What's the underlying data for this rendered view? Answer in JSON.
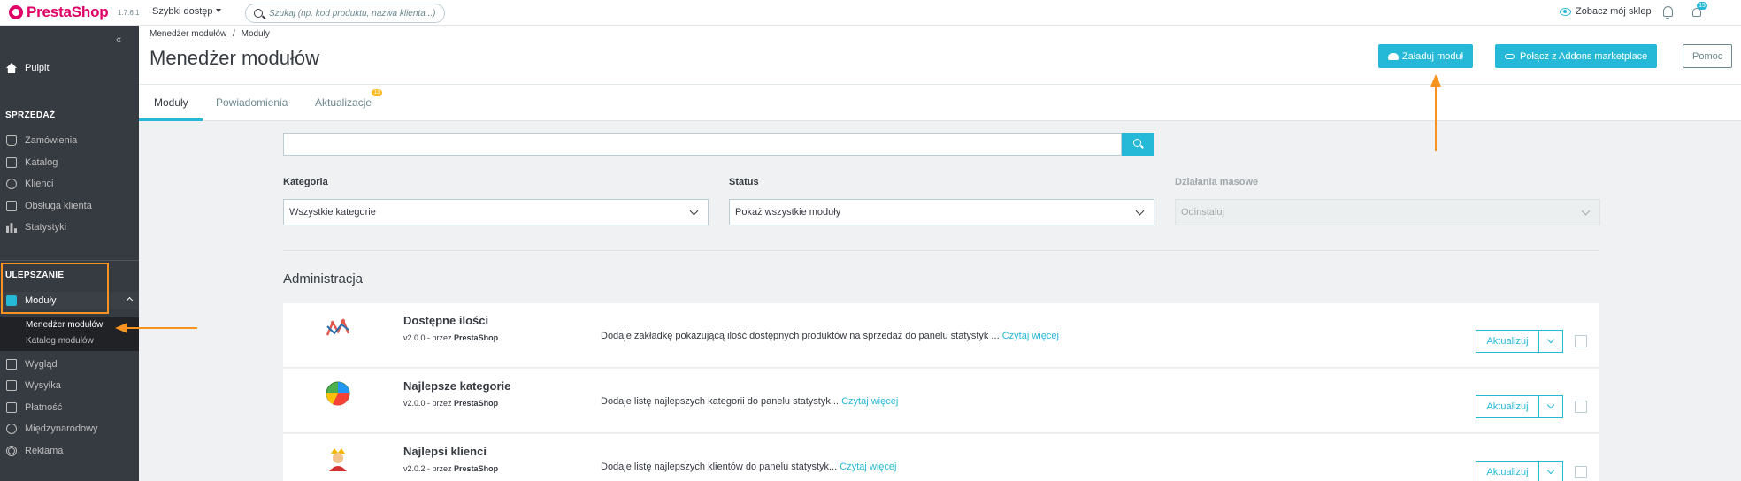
{
  "topbar": {
    "brand_prefix": "Presta",
    "brand_suffix": "Shop",
    "version": "1.7.6.1",
    "quick_access": "Szybki dostęp",
    "search_placeholder": "Szukaj (np. kod produktu, nazwa klienta...)",
    "view_shop": "Zobacz mój sklep",
    "notif_count": "15"
  },
  "sidebar": {
    "dashboard": "Pulpit",
    "section_sell": "SPRZEDAŻ",
    "sell_items": [
      "Zamówienia",
      "Katalog",
      "Klienci",
      "Obsługa klienta",
      "Statystyki"
    ],
    "section_improve": "ULEPSZANIE",
    "modules": "Moduły",
    "sub_items": [
      "Menedżer modułów",
      "Katalog modułów"
    ],
    "improve_items": [
      "Wygląd",
      "Wysyłka",
      "Płatność",
      "Międzynarodowy",
      "Reklama"
    ]
  },
  "header": {
    "breadcrumb_1": "Menedżer modułów",
    "breadcrumb_sep": "/",
    "breadcrumb_2": "Moduły",
    "title": "Menedżer modułów",
    "upload_button": "Załaduj moduł",
    "addons_button": "Połącz z Addons marketplace",
    "help_button": "Pomoc"
  },
  "tabs": {
    "items": [
      "Moduły",
      "Powiadomienia",
      "Aktualizacje"
    ],
    "updates_badge": "13"
  },
  "filters": {
    "search_value": "",
    "category_label": "Kategoria",
    "category_value": "Wszystkie kategorie",
    "status_label": "Status",
    "status_value": "Pokaż wszystkie moduły",
    "bulk_label": "Działania masowe",
    "bulk_value": "Odinstaluj"
  },
  "section": {
    "title": "Administracja"
  },
  "modules": [
    {
      "name": "Dostępne ilości",
      "version": "v2.0.0 - przez",
      "author": "PrestaShop",
      "description": "Dodaje zakładkę pokazującą ilość dostępnych produktów na sprzedaż do panelu statystyk ...",
      "more": "Czytaj więcej",
      "action": "Aktualizuj",
      "icon": "line-chart-icon"
    },
    {
      "name": "Najlepsze kategorie",
      "version": "v2.0.0 - przez",
      "author": "PrestaShop",
      "description": "Dodaje listę najlepszych kategorii do panelu statystyk...",
      "more": "Czytaj więcej",
      "action": "Aktualizuj",
      "icon": "pie-chart-icon"
    },
    {
      "name": "Najlepsi klienci",
      "version": "v2.0.2 - przez",
      "author": "PrestaShop",
      "description": "Dodaje listę najlepszych klientów do panelu statystyk...",
      "more": "Czytaj więcej",
      "action": "Aktualizuj",
      "icon": "king-icon"
    }
  ],
  "colors": {
    "accent": "#25b9d7",
    "sidebar": "#363a41",
    "annotation": "#f7931e",
    "brand": "#df0067"
  }
}
